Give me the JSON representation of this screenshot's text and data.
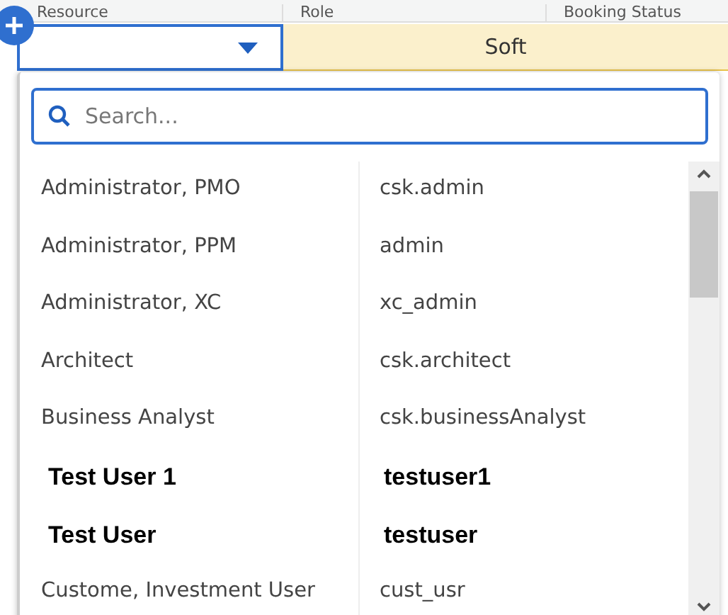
{
  "table": {
    "columns": [
      "Resource",
      "Role",
      "Booking Status"
    ],
    "row": {
      "booking_status": "Soft"
    }
  },
  "dropdown": {
    "search": {
      "placeholder": "Search..."
    },
    "items": [
      {
        "name": "Administrator, PMO",
        "user": "csk.admin",
        "kind": "normal"
      },
      {
        "name": "Administrator, PPM",
        "user": "admin",
        "kind": "normal"
      },
      {
        "name": "Administrator, XC",
        "user": "xc_admin",
        "kind": "normal"
      },
      {
        "name": "Architect",
        "user": "csk.architect",
        "kind": "normal"
      },
      {
        "name": "Business Analyst",
        "user": "csk.businessAnalyst",
        "kind": "normal"
      },
      {
        "name": "Test User 1",
        "user": "testuser1",
        "kind": "bold"
      },
      {
        "name": "Test User",
        "user": "testuser",
        "kind": "bold"
      },
      {
        "name": "Custome, Investment User",
        "user": "cust_usr",
        "kind": "normal"
      }
    ]
  }
}
